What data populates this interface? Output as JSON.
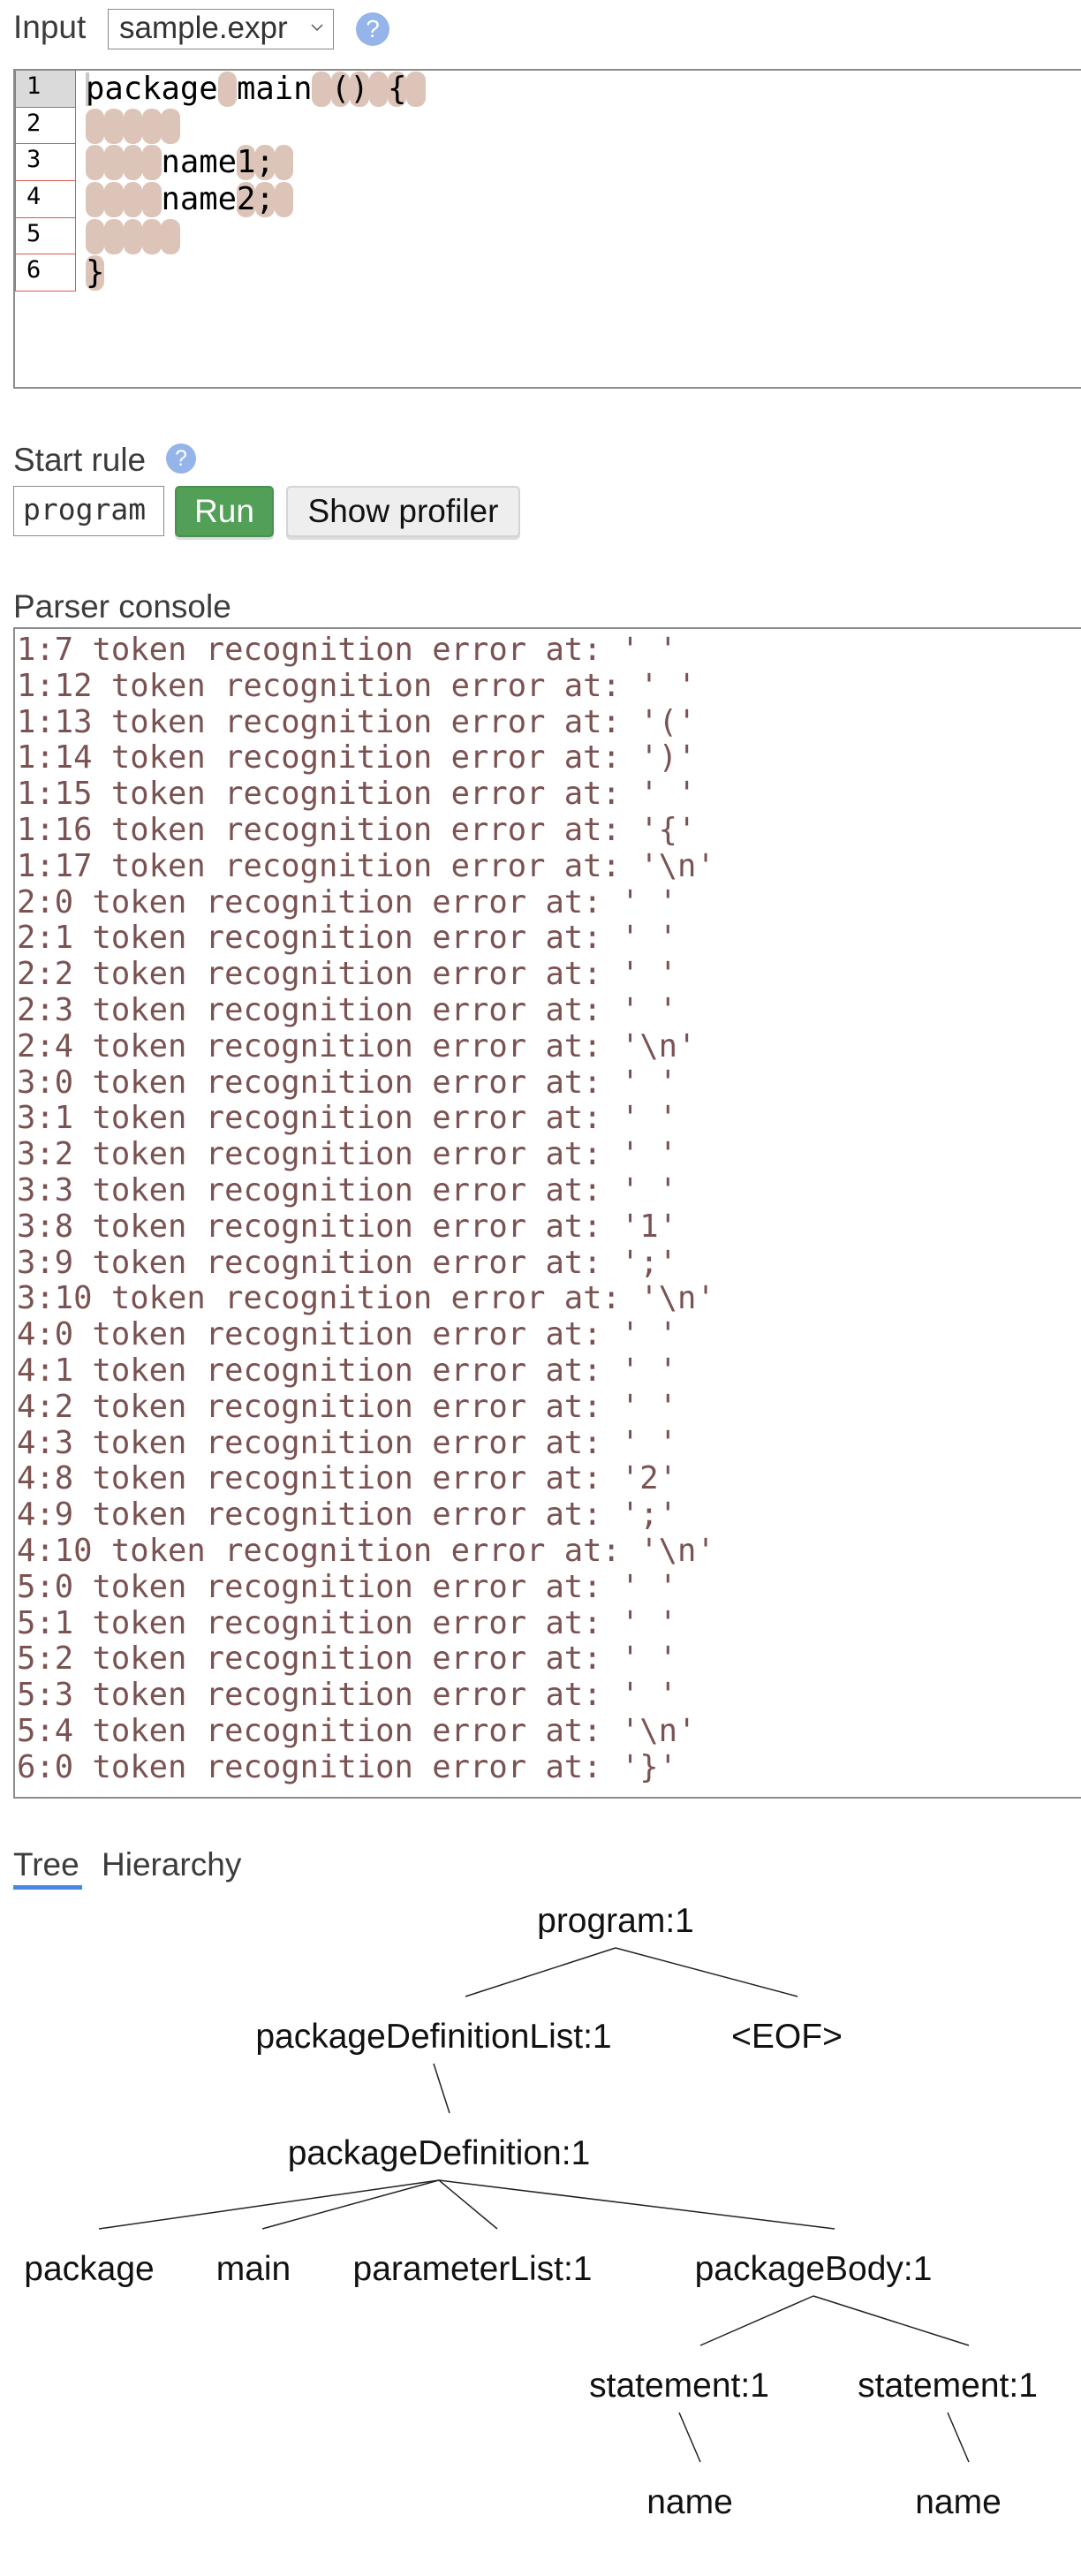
{
  "input_section": {
    "label": "Input",
    "file_select": {
      "selected": "sample.expr"
    },
    "help_glyph": "?"
  },
  "editor": {
    "line_numbers": [
      "1",
      "2",
      "3",
      "4",
      "5",
      "6"
    ],
    "lines": [
      {
        "text": "package main () {",
        "error_columns": [
          7,
          12,
          13,
          14,
          15,
          16,
          17
        ]
      },
      {
        "text": "    ",
        "error_columns": [
          0,
          1,
          2,
          3,
          4
        ]
      },
      {
        "text": "    name1;",
        "error_columns": [
          0,
          1,
          2,
          3,
          8,
          9,
          10
        ]
      },
      {
        "text": "    name2;",
        "error_columns": [
          0,
          1,
          2,
          3,
          8,
          9,
          10
        ]
      },
      {
        "text": "    ",
        "error_columns": [
          0,
          1,
          2,
          3,
          4
        ]
      },
      {
        "text": "}",
        "error_columns": [
          0
        ]
      }
    ],
    "error_highlight_color": "#dcc4b9"
  },
  "start_rule": {
    "label": "Start rule",
    "help_glyph": "?",
    "value": "program",
    "run_label": "Run",
    "profiler_label": "Show profiler"
  },
  "parser_console": {
    "label": "Parser console",
    "text_color": "#7b5252",
    "lines": [
      "1:7 token recognition error at: ' '",
      "1:12 token recognition error at: ' '",
      "1:13 token recognition error at: '('",
      "1:14 token recognition error at: ')'",
      "1:15 token recognition error at: ' '",
      "1:16 token recognition error at: '{'",
      "1:17 token recognition error at: '\\n'",
      "2:0 token recognition error at: ' '",
      "2:1 token recognition error at: ' '",
      "2:2 token recognition error at: ' '",
      "2:3 token recognition error at: ' '",
      "2:4 token recognition error at: '\\n'",
      "3:0 token recognition error at: ' '",
      "3:1 token recognition error at: ' '",
      "3:2 token recognition error at: ' '",
      "3:3 token recognition error at: ' '",
      "3:8 token recognition error at: '1'",
      "3:9 token recognition error at: ';'",
      "3:10 token recognition error at: '\\n'",
      "4:0 token recognition error at: ' '",
      "4:1 token recognition error at: ' '",
      "4:2 token recognition error at: ' '",
      "4:3 token recognition error at: ' '",
      "4:8 token recognition error at: '2'",
      "4:9 token recognition error at: ';'",
      "4:10 token recognition error at: '\\n'",
      "5:0 token recognition error at: ' '",
      "5:1 token recognition error at: ' '",
      "5:2 token recognition error at: ' '",
      "5:3 token recognition error at: ' '",
      "5:4 token recognition error at: '\\n'",
      "6:0 token recognition error at: '}'"
    ]
  },
  "tabs": {
    "items": [
      {
        "label": "Tree",
        "active": true
      },
      {
        "label": "Hierarchy",
        "active": false
      }
    ],
    "accent_color": "#4a86e8"
  },
  "parse_tree": {
    "nodes": [
      {
        "id": "program",
        "label": "program:1",
        "parent": null,
        "depth": 0
      },
      {
        "id": "pdl",
        "label": "packageDefinitionList:1",
        "parent": "program",
        "depth": 1
      },
      {
        "id": "eof",
        "label": "<EOF>",
        "parent": "program",
        "depth": 1
      },
      {
        "id": "pd",
        "label": "packageDefinition:1",
        "parent": "pdl",
        "depth": 2
      },
      {
        "id": "kw_package",
        "label": "package",
        "parent": "pd",
        "depth": 3
      },
      {
        "id": "kw_main",
        "label": "main",
        "parent": "pd",
        "depth": 3
      },
      {
        "id": "plist",
        "label": "parameterList:1",
        "parent": "pd",
        "depth": 3
      },
      {
        "id": "pbody",
        "label": "packageBody:1",
        "parent": "pd",
        "depth": 3
      },
      {
        "id": "st1",
        "label": "statement:1",
        "parent": "pbody",
        "depth": 4
      },
      {
        "id": "st2",
        "label": "statement:1",
        "parent": "pbody",
        "depth": 4
      },
      {
        "id": "name1",
        "label": "name",
        "parent": "st1",
        "depth": 5
      },
      {
        "id": "name2",
        "label": "name",
        "parent": "st2",
        "depth": 5
      }
    ]
  }
}
